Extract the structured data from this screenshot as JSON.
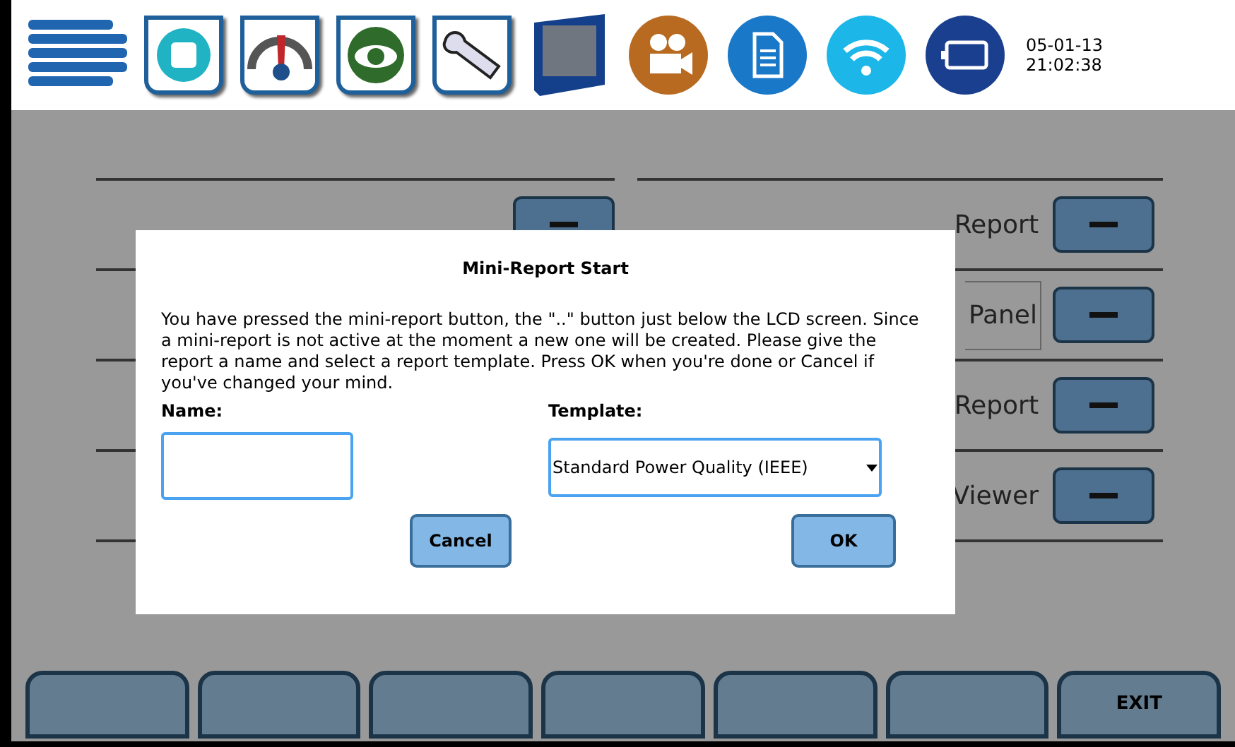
{
  "top_bar": {
    "date": "05-01-13",
    "time": "21:02:38"
  },
  "report_rows": [
    {
      "label": "Report",
      "boxed": false
    },
    {
      "label": "Panel",
      "boxed": true
    },
    {
      "label": "Report",
      "boxed": false
    },
    {
      "label": "Viewer",
      "boxed": false
    }
  ],
  "dialog": {
    "title": "Mini-Report Start",
    "message": "You have pressed the mini-report button, the \"..\" button just below the LCD screen.  Since a mini-report is not active at the moment a new one will be created.  Please give the report a name and select a report template.  Press OK when you're done or Cancel if you've changed your mind.",
    "name_label": "Name:",
    "template_label": "Template:",
    "template_value": "Standard Power Quality (IEEE)",
    "cancel": "Cancel",
    "ok": "OK"
  },
  "soft_keys": [
    {
      "kind": "blank"
    },
    {
      "kind": "blank"
    },
    {
      "kind": "blank"
    },
    {
      "kind": "blank"
    },
    {
      "kind": "blank"
    },
    {
      "kind": "blank"
    },
    {
      "kind": "label",
      "label": "EXIT"
    }
  ]
}
